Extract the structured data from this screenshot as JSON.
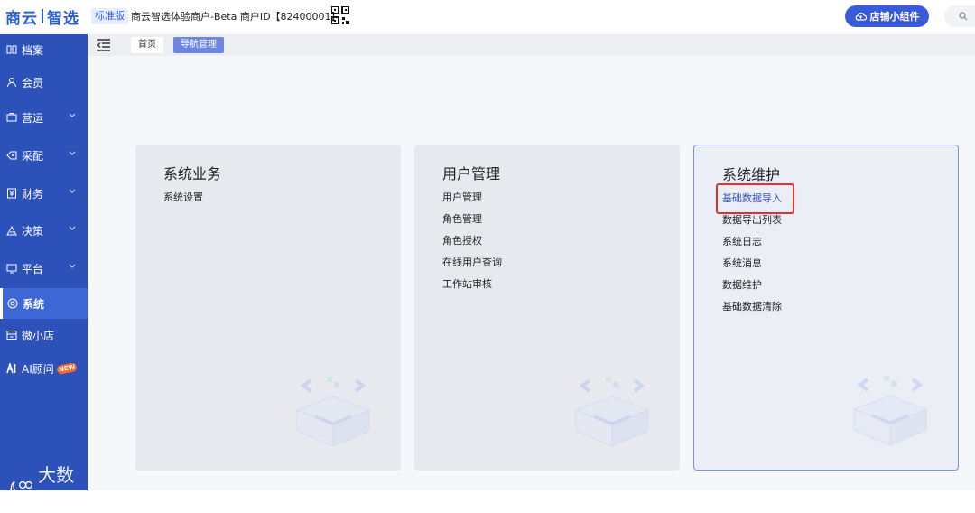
{
  "topbar": {
    "brand_left": "商云",
    "brand_right": "智选",
    "edition": "标准版",
    "merchant": "商云智选体验商户-Beta  商户ID【82400001】",
    "qr_icon": "qr-code-icon",
    "widget_button": "店铺小组件"
  },
  "sidebar": {
    "items": [
      {
        "label": "档案",
        "icon": "archive-icon"
      },
      {
        "label": "会员",
        "icon": "user-icon"
      },
      {
        "label": "营运",
        "icon": "operations-icon"
      },
      {
        "label": "采配",
        "icon": "purchase-icon"
      },
      {
        "label": "财务",
        "icon": "finance-icon"
      },
      {
        "label": "决策",
        "icon": "decision-icon"
      },
      {
        "label": "平台",
        "icon": "platform-icon"
      },
      {
        "label": "系统",
        "icon": "system-icon"
      },
      {
        "label": "微小店",
        "icon": "mini-shop-icon"
      },
      {
        "label": "AI顾问",
        "icon": "ai-icon",
        "badge": "NEW"
      }
    ],
    "active": "系统",
    "watermark": "大数跨境"
  },
  "tabs": [
    {
      "label": "首页"
    },
    {
      "label": "导航管理"
    }
  ],
  "cards": [
    {
      "title": "系统业务",
      "links": [
        "系统设置"
      ]
    },
    {
      "title": "用户管理",
      "links": [
        "用户管理",
        "角色管理",
        "角色授权",
        "在线用户查询",
        "工作站审核"
      ]
    },
    {
      "title": "系统维护",
      "links": [
        "基础数据导入",
        "数据导出列表",
        "系统日志",
        "系统消息",
        "数据维护",
        "基础数据清除"
      ],
      "highlighted": "基础数据导入"
    }
  ],
  "colors": {
    "sidebar": "#2c52b9",
    "accent": "#3a5bd8",
    "highlight_border": "#e0322e"
  }
}
